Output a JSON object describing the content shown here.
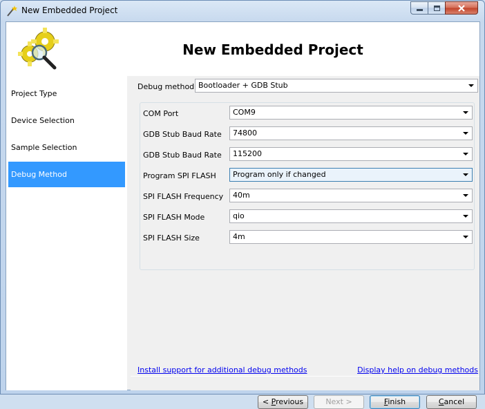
{
  "window": {
    "title": "New Embedded Project",
    "controls": {
      "minimize": "minimize-icon",
      "maximize": "maximize-icon",
      "close": "close-icon"
    }
  },
  "banner": {
    "title": "New Embedded Project",
    "icon": "gears-magnifier-icon"
  },
  "nav": {
    "items": [
      {
        "label": "Project Type"
      },
      {
        "label": "Device Selection"
      },
      {
        "label": "Sample Selection"
      },
      {
        "label": "Debug Method",
        "active": true
      }
    ]
  },
  "debug": {
    "label": "Debug method:",
    "value": "Bootloader + GDB Stub"
  },
  "settings": [
    {
      "label": "COM Port",
      "value": "COM9"
    },
    {
      "label": "GDB Stub Baud Rate",
      "value": "74800"
    },
    {
      "label": "GDB Stub Baud Rate",
      "value": "115200"
    },
    {
      "label": "Program SPI FLASH",
      "value": "Program only if changed"
    },
    {
      "label": "SPI FLASH Frequency",
      "value": "40m"
    },
    {
      "label": "SPI FLASH Mode",
      "value": "qio"
    },
    {
      "label": "SPI FLASH Size",
      "value": "4m"
    }
  ],
  "links": {
    "install": "Install support for additional debug methods",
    "help": "Display help on debug methods"
  },
  "buttons": {
    "previous": {
      "mnemonic": "P",
      "rest": "revious",
      "prefix": "< "
    },
    "next": {
      "label": "Next >"
    },
    "finish": {
      "mnemonic": "F",
      "rest": "inish"
    },
    "cancel": {
      "mnemonic": "C",
      "rest": "ancel"
    }
  },
  "colors": {
    "selection": "#3399ff",
    "link": "#0000ee"
  }
}
